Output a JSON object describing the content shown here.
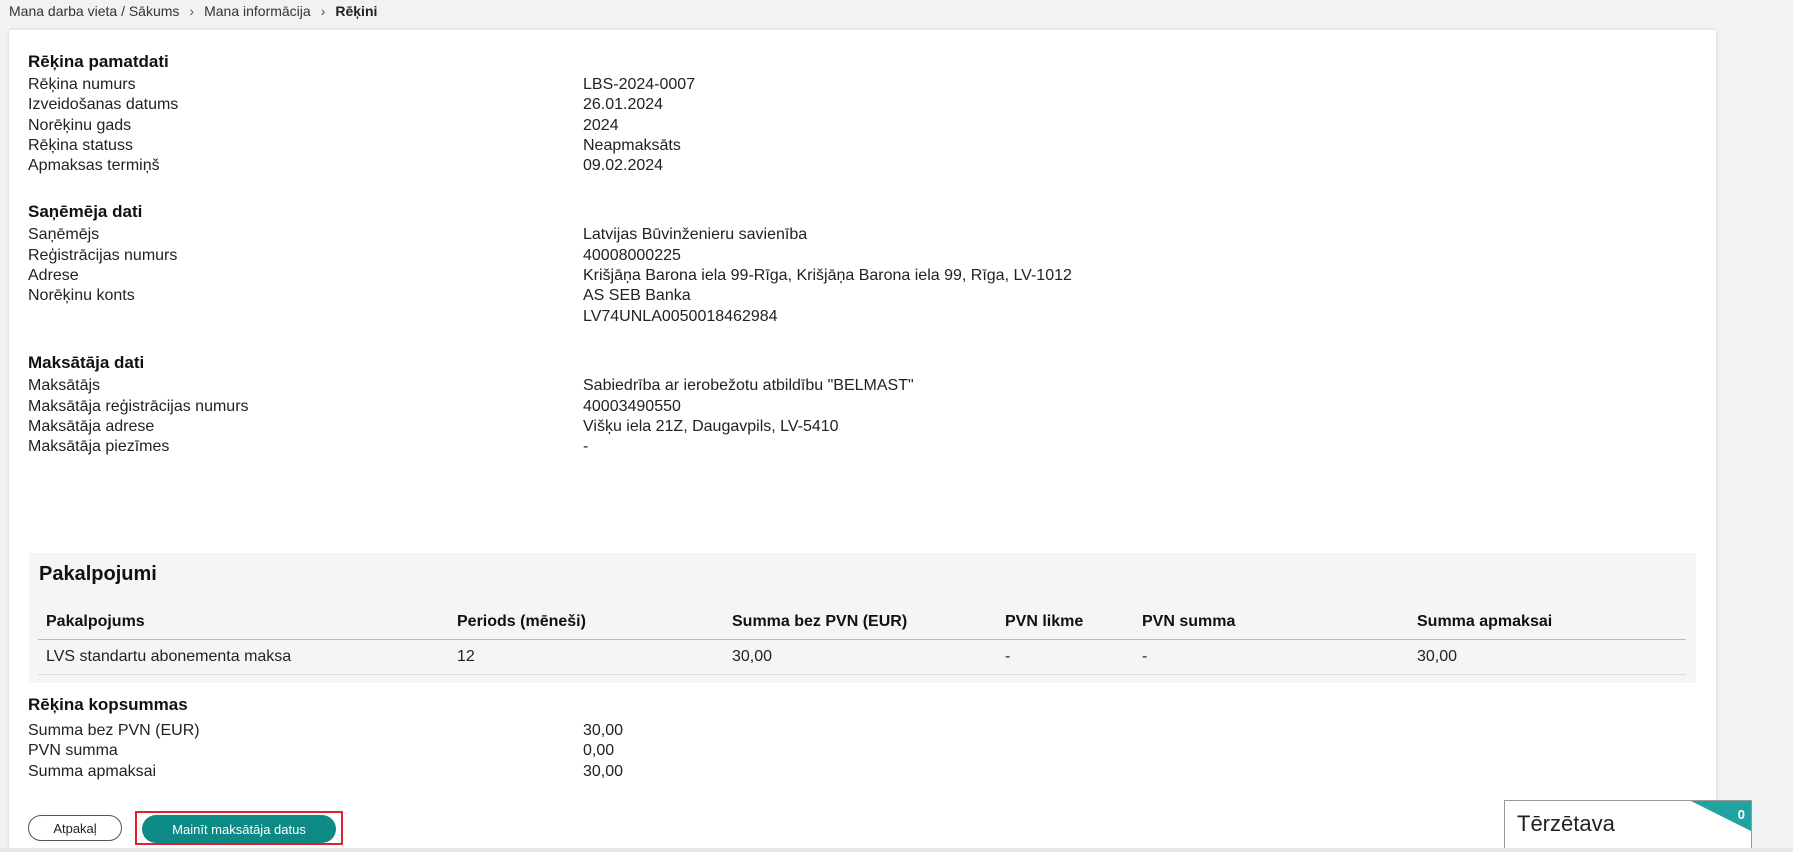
{
  "breadcrumb": {
    "item1": "Mana darba vieta / Sākums",
    "item2": "Mana informācija",
    "current": "Rēķini",
    "separator": "›"
  },
  "invoice_basic": {
    "title": "Rēķina pamatdati",
    "rows": [
      {
        "label": "Rēķina numurs",
        "value": "LBS-2024-0007"
      },
      {
        "label": "Izveidošanas datums",
        "value": "26.01.2024"
      },
      {
        "label": "Norēķinu gads",
        "value": "2024"
      },
      {
        "label": "Rēķina statuss",
        "value": "Neapmaksāts"
      },
      {
        "label": "Apmaksas termiņš",
        "value": "09.02.2024"
      }
    ]
  },
  "recipient": {
    "title": "Saņēmēja dati",
    "rows": [
      {
        "label": "Saņēmējs",
        "value": "Latvijas Būvinženieru savienība"
      },
      {
        "label": "Reģistrācijas numurs",
        "value": "40008000225"
      },
      {
        "label": "Adrese",
        "value": "Krišjāņa Barona iela 99-Rīga, Krišjāņa Barona iela 99, Rīga, LV-1012"
      },
      {
        "label": "Norēķinu konts",
        "value": "AS SEB Banka"
      }
    ],
    "account_number": "LV74UNLA0050018462984"
  },
  "payer": {
    "title": "Maksātāja dati",
    "rows": [
      {
        "label": "Maksātājs",
        "value": "Sabiedrība ar ierobežotu atbildību \"BELMAST\""
      },
      {
        "label": "Maksātāja reģistrācijas numurs",
        "value": "40003490550"
      },
      {
        "label": "Maksātāja adrese",
        "value": "Višķu iela 21Z, Daugavpils, LV-5410"
      },
      {
        "label": "Maksātāja piezīmes",
        "value": "-"
      }
    ]
  },
  "services": {
    "title": "Pakalpojumi",
    "columns": [
      "Pakalpojums",
      "Periods (mēneši)",
      "Summa bez PVN (EUR)",
      "PVN likme",
      "PVN summa",
      "Summa apmaksai"
    ],
    "rows": [
      [
        "LVS standartu abonementa maksa",
        "12",
        "30,00",
        "-",
        "-",
        "30,00"
      ]
    ]
  },
  "totals": {
    "title": "Rēķina kopsummas",
    "rows": [
      {
        "label": "Summa bez PVN (EUR)",
        "value": "30,00"
      },
      {
        "label": "PVN summa",
        "value": "0,00"
      },
      {
        "label": "Summa apmaksai",
        "value": "30,00"
      }
    ]
  },
  "actions": {
    "back_label": "Atpakaļ",
    "change_payer_label": "Mainīt maksātāja datus"
  },
  "chat": {
    "title": "Tērzētava",
    "count": "0"
  },
  "colors": {
    "accent": "#0e8a86",
    "chat_badge": "#22a3a0",
    "highlight": "#e0212b"
  }
}
